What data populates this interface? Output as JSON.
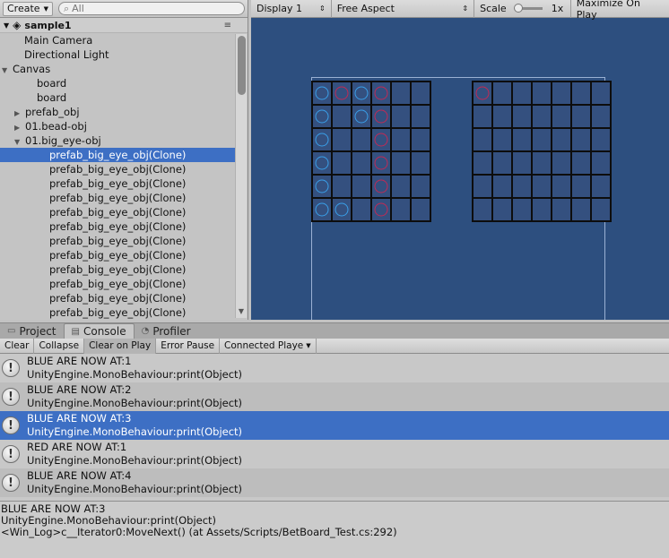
{
  "hierarchy": {
    "create_label": "Create",
    "search_placeholder": "All",
    "scene_name": "sample1",
    "scene_menu": "≡",
    "items": [
      {
        "label": "Main Camera"
      },
      {
        "label": "Directional Light"
      },
      {
        "label": "Canvas"
      },
      {
        "label": "board"
      },
      {
        "label": "board"
      },
      {
        "label": "prefab_obj"
      },
      {
        "label": "01.bead-obj"
      },
      {
        "label": "01.big_eye-obj"
      },
      {
        "label": "prefab_big_eye_obj(Clone)"
      },
      {
        "label": "prefab_big_eye_obj(Clone)"
      },
      {
        "label": "prefab_big_eye_obj(Clone)"
      },
      {
        "label": "prefab_big_eye_obj(Clone)"
      },
      {
        "label": "prefab_big_eye_obj(Clone)"
      },
      {
        "label": "prefab_big_eye_obj(Clone)"
      },
      {
        "label": "prefab_big_eye_obj(Clone)"
      },
      {
        "label": "prefab_big_eye_obj(Clone)"
      },
      {
        "label": "prefab_big_eye_obj(Clone)"
      },
      {
        "label": "prefab_big_eye_obj(Clone)"
      },
      {
        "label": "prefab_big_eye_obj(Clone)"
      },
      {
        "label": "prefab_big_eye_obj(Clone)"
      }
    ]
  },
  "game_toolbar": {
    "display": "Display 1",
    "aspect": "Free Aspect",
    "scale_label": "Scale",
    "scale_value": "1x",
    "maximize": "Maximize On Play"
  },
  "board_colors": {
    "blue": "#3a9fe8",
    "red": "#c02a55",
    "background": "#2d4f7f"
  },
  "bottom_tabs": {
    "project": "Project",
    "console": "Console",
    "profiler": "Profiler"
  },
  "console_toolbar": {
    "clear": "Clear",
    "collapse": "Collapse",
    "clear_on_play": "Clear on Play",
    "error_pause": "Error Pause",
    "connected_player": "Connected Playe"
  },
  "logs": [
    {
      "line1": "BLUE ARE NOW AT:1",
      "line2": "UnityEngine.MonoBehaviour:print(Object)"
    },
    {
      "line1": "BLUE ARE NOW AT:2",
      "line2": "UnityEngine.MonoBehaviour:print(Object)"
    },
    {
      "line1": "BLUE ARE NOW AT:3",
      "line2": "UnityEngine.MonoBehaviour:print(Object)"
    },
    {
      "line1": "RED ARE NOW AT:1",
      "line2": "UnityEngine.MonoBehaviour:print(Object)"
    },
    {
      "line1": "BLUE ARE NOW AT:4",
      "line2": "UnityEngine.MonoBehaviour:print(Object)"
    }
  ],
  "detail": {
    "line1": "BLUE ARE NOW AT:3",
    "line2": "UnityEngine.MonoBehaviour:print(Object)",
    "line3": "<Win_Log>c__Iterator0:MoveNext() (at Assets/Scripts/BetBoard_Test.cs:292)"
  }
}
